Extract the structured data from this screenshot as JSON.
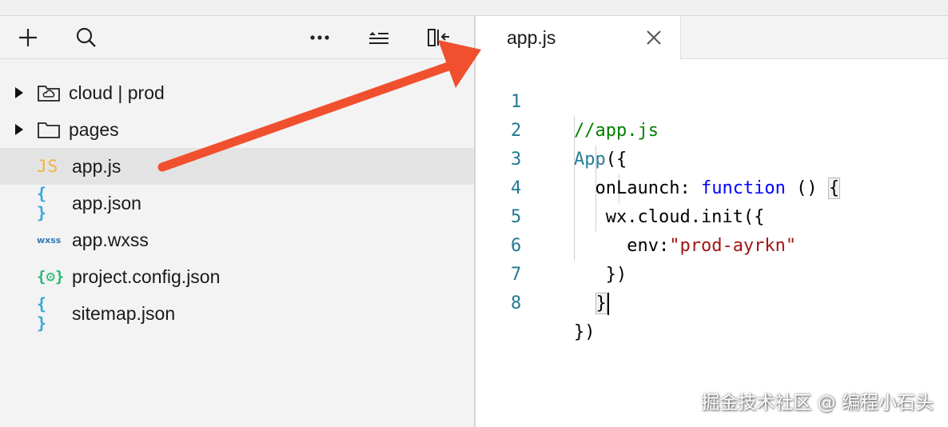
{
  "sidebar": {
    "toolbar": {
      "icons": [
        "plus-icon",
        "search-icon",
        "more-icon",
        "collapse-all-icon",
        "hide-sidebar-icon"
      ]
    },
    "tree": [
      {
        "label": "cloud | prod",
        "kind": "folder",
        "icon": "cloud-folder-icon",
        "expandable": true
      },
      {
        "label": "pages",
        "kind": "folder",
        "icon": "folder-icon",
        "expandable": true
      },
      {
        "label": "app.js",
        "kind": "file",
        "icon": "js-file-icon",
        "badge": "JS",
        "selected": true
      },
      {
        "label": "app.json",
        "kind": "file",
        "icon": "json-file-icon",
        "badge": "{ }"
      },
      {
        "label": "app.wxss",
        "kind": "file",
        "icon": "wxss-file-icon",
        "badge": "wxss"
      },
      {
        "label": "project.config.json",
        "kind": "file",
        "icon": "config-file-icon",
        "badge": "{⚙}"
      },
      {
        "label": "sitemap.json",
        "kind": "file",
        "icon": "json-file-icon",
        "badge": "{ }"
      }
    ]
  },
  "editor": {
    "tab": {
      "label": "app.js",
      "close_icon": "close-icon"
    },
    "lines": [
      {
        "num": "1",
        "tokens": [
          {
            "t": "//app.js",
            "c": "comment"
          }
        ]
      },
      {
        "num": "2",
        "tokens": [
          {
            "t": "App",
            "c": "fn"
          },
          {
            "t": "({",
            "c": "plain"
          }
        ]
      },
      {
        "num": "3",
        "tokens": [
          {
            "t": "  onLaunch: ",
            "c": "plain"
          },
          {
            "t": "function",
            "c": "kw"
          },
          {
            "t": " () ",
            "c": "plain"
          },
          {
            "t": "{",
            "c": "bracket"
          }
        ]
      },
      {
        "num": "4",
        "tokens": [
          {
            "t": "   wx.cloud.init({",
            "c": "plain"
          }
        ]
      },
      {
        "num": "5",
        "tokens": [
          {
            "t": "     env:",
            "c": "plain"
          },
          {
            "t": "\"prod-ayrkn\"",
            "c": "str"
          }
        ]
      },
      {
        "num": "6",
        "tokens": [
          {
            "t": "   })",
            "c": "plain"
          }
        ]
      },
      {
        "num": "7",
        "tokens": [
          {
            "t": "  ",
            "c": "plain"
          },
          {
            "t": "}",
            "c": "bracket-cursor"
          }
        ]
      },
      {
        "num": "8",
        "tokens": [
          {
            "t": "})",
            "c": "plain"
          }
        ]
      }
    ]
  },
  "annotation": {
    "arrow_color": "#f0502e"
  },
  "watermark": "掘金技术社区 @ 编程小石头"
}
